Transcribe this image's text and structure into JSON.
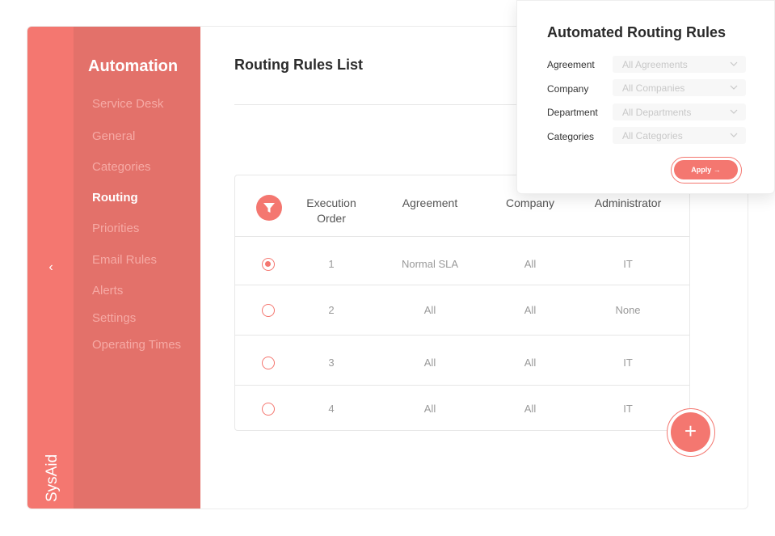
{
  "colors": {
    "accent": "#f47770",
    "nav_bg": "#e3716a",
    "nav_muted": "#f6aaa5"
  },
  "brand": {
    "logo_text": "SysAid"
  },
  "nav": {
    "title": "Automation",
    "items": [
      {
        "label": "Service Desk",
        "active": false
      },
      {
        "label": "General",
        "active": false
      },
      {
        "label": "Categories",
        "active": false
      },
      {
        "label": "Routing",
        "active": true
      },
      {
        "label": "Priorities",
        "active": false
      },
      {
        "label": "Email Rules",
        "active": false
      },
      {
        "label": "Alerts",
        "active": false
      },
      {
        "label": "Settings",
        "active": false
      },
      {
        "label": "Operating Times",
        "active": false
      }
    ],
    "collapse_icon": "chevron-left-icon"
  },
  "main": {
    "title": "Routing Rules List",
    "table": {
      "headers": [
        "Execution Order",
        "Agreement",
        "Company",
        "Administrator"
      ],
      "rows": [
        {
          "order": "1",
          "agreement": "Normal SLA",
          "company": "All",
          "administrator": "IT",
          "selected": true
        },
        {
          "order": "2",
          "agreement": "All",
          "company": "All",
          "administrator": "None",
          "selected": false
        },
        {
          "order": "3",
          "agreement": "All",
          "company": "All",
          "administrator": "IT",
          "selected": false
        },
        {
          "order": "4",
          "agreement": "All",
          "company": "All",
          "administrator": "IT",
          "selected": false
        }
      ]
    },
    "add_button": "+"
  },
  "popup": {
    "title": "Automated Routing Rules",
    "filters": [
      {
        "label": "Agreement",
        "placeholder": "All Agreements"
      },
      {
        "label": "Company",
        "placeholder": "All Companies"
      },
      {
        "label": "Department",
        "placeholder": "All Departments"
      },
      {
        "label": "Categories",
        "placeholder": "All Categories"
      }
    ],
    "apply_label": "Apply →"
  }
}
